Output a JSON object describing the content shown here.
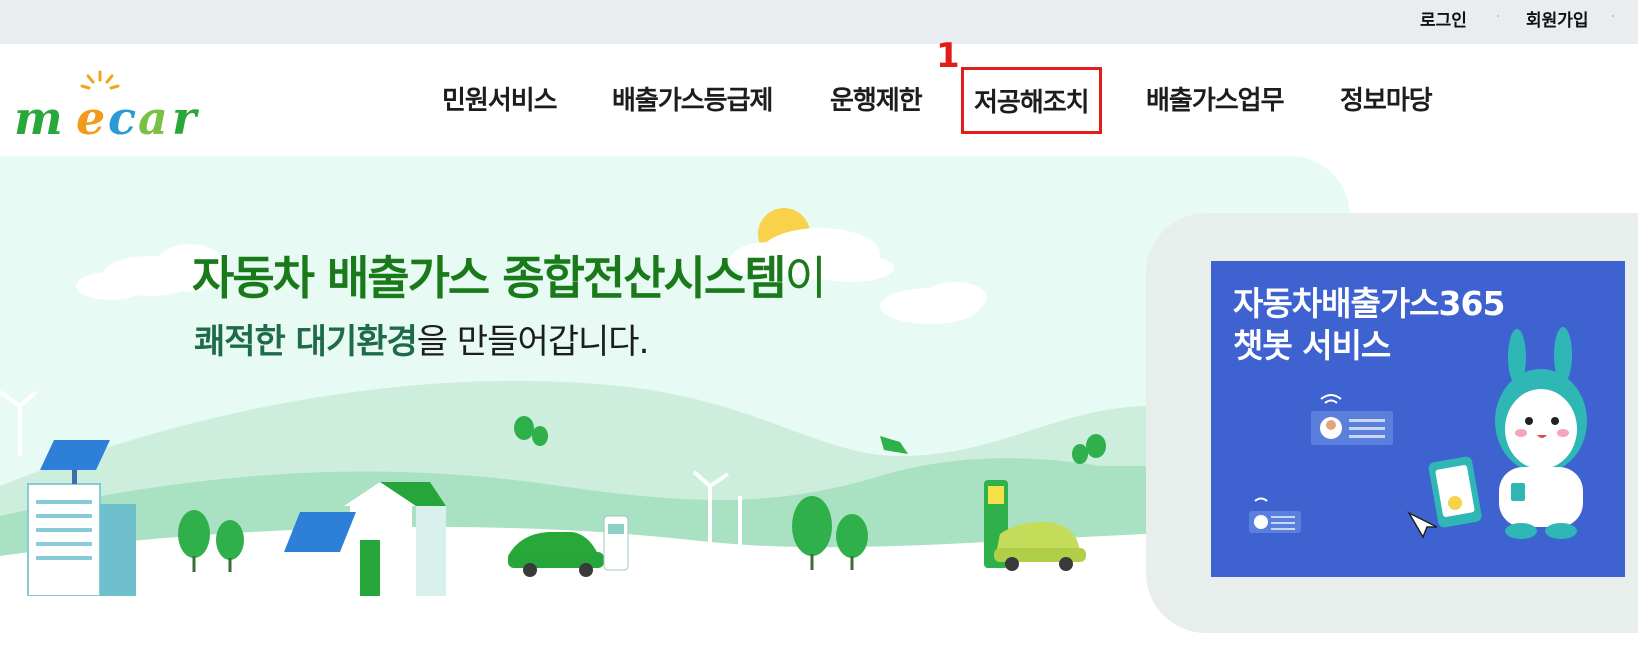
{
  "topbar": {
    "login_label": "로그인",
    "join_label": "회원가입"
  },
  "logo": {
    "text": "mecar"
  },
  "nav": {
    "items": [
      {
        "label": "민원서비스"
      },
      {
        "label": "배출가스등급제"
      },
      {
        "label": "운행제한"
      },
      {
        "label": "저공해조치"
      },
      {
        "label": "배출가스업무"
      },
      {
        "label": "정보마당"
      }
    ],
    "highlight_marker": "1"
  },
  "hero": {
    "headline_bold": "자동차 배출가스 종합전산시스템",
    "headline_tail": "이",
    "sub_bold": "쾌적한 대기환경",
    "sub_rest": "을 만들어갑니다."
  },
  "chatbot_banner": {
    "title_line1": "자동차배출가스365",
    "title_line2": "챗봇 서비스"
  },
  "colors": {
    "topbar_bg": "#eaedf0",
    "highlight_box": "#e21b1b",
    "hero_bg": "#e7fbf4",
    "headline_green": "#1a7a1a",
    "banner_blue": "#3e63d1",
    "panel_bg": "#e8eeec"
  }
}
